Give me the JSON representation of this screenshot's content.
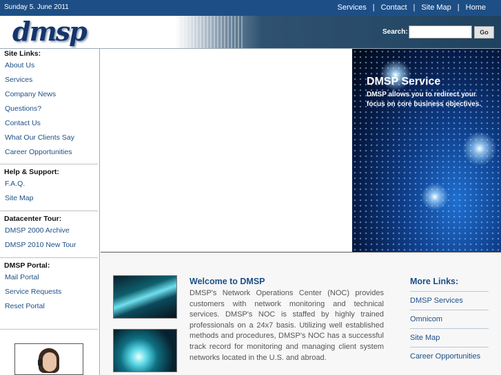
{
  "topbar": {
    "date": "Sunday 5. June 2011",
    "nav": [
      "Services",
      "Contact",
      "Site Map",
      "Home"
    ],
    "separator": "|"
  },
  "header": {
    "logo_text": "dmsp",
    "search_label": "Search:",
    "search_value": "",
    "go_label": "Go"
  },
  "sidebar": {
    "sections": [
      {
        "title": "Site Links:",
        "links": [
          "About Us",
          "Services",
          "Company News",
          "Questions?",
          "Contact Us",
          "What Our Clients Say",
          "Career Opportunities"
        ]
      },
      {
        "title": "Help & Support:",
        "links": [
          "F.A.Q.",
          "Site Map"
        ]
      },
      {
        "title": "Datacenter Tour:",
        "links": [
          "DMSP 2000 Archive",
          "DMSP 2010 New Tour"
        ]
      },
      {
        "title": "DMSP Portal:",
        "links": [
          "Mail Portal",
          "Service Requests",
          "Reset Portal"
        ]
      }
    ]
  },
  "hero": {
    "title": "DMSP Service",
    "subtitle": "DMSP allows you to redirect your focus on core business objectives."
  },
  "welcome": {
    "title": "Welcome to DMSP",
    "text": "DMSP's Network Operations Center (NOC) provides customers with network monitoring and technical services. DMSP's NOC is staffed by highly trained professionals on a 24x7 basis. Utilizing well established methods and procedures, DMSP's NOC has a successful track record for monitoring and managing client system networks located in the U.S. and abroad."
  },
  "more_links": {
    "title": "More Links:",
    "links": [
      "DMSP Services",
      "Omnicom",
      "Site Map",
      "Career Opportunities"
    ]
  },
  "colors": {
    "brand_blue": "#1d4f86",
    "topbar": "#1d4f86",
    "link": "#1d4f86"
  }
}
